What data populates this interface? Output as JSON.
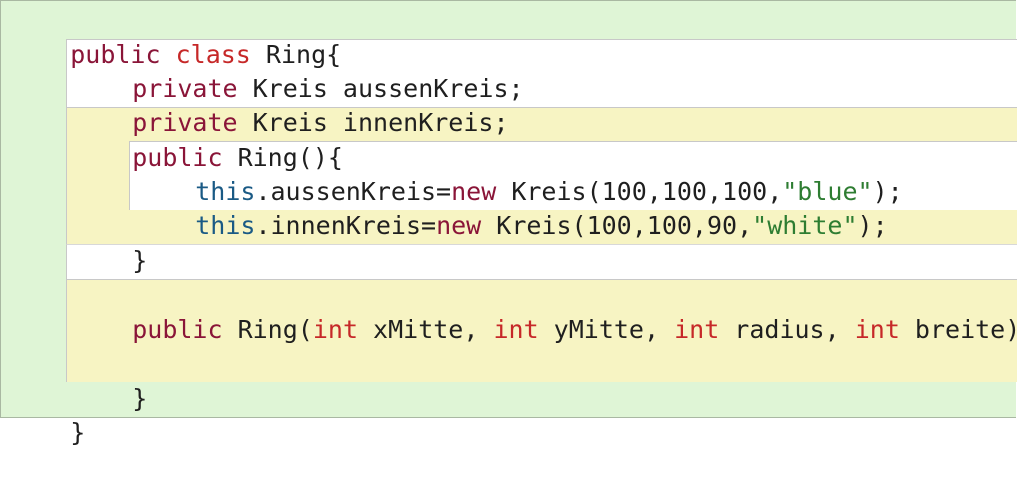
{
  "editor": {
    "lines": {
      "class_header": {
        "kw1": "public",
        "kw2": "class",
        "rest": " Ring{"
      },
      "field1": {
        "kw": "private",
        "rest": " Kreis aussenKreis;"
      },
      "field2": {
        "kw": "private",
        "rest": " Kreis innenKreis;"
      },
      "ctor1_header": {
        "kw": "public",
        "rest": " Ring(){"
      },
      "stmt1": {
        "this": "this",
        "mid1": ".aussenKreis=",
        "new": "new",
        "mid2": " Kreis(100,100,100,",
        "str": "\"blue\"",
        "end": ");"
      },
      "stmt2": {
        "this": "this",
        "mid1": ".innenKreis=",
        "new": "new",
        "mid2": " Kreis(100,100,90,",
        "str": "\"white\"",
        "end": ");"
      },
      "ctor1_close": "}",
      "ctor2_header": {
        "kw": "public",
        "name": " Ring(",
        "t1": "int",
        "p1": " xMitte, ",
        "t2": "int",
        "p2": " yMitte, ",
        "t3": "int",
        "p3": " radius, ",
        "t4": "int",
        "p4": " breite){"
      },
      "ctor2_close": "}",
      "class_close": "}"
    },
    "colors": {
      "keyword": "#8a1538",
      "type": "#c62828",
      "this": "#1a5a85",
      "string": "#2e7d32",
      "class_scope_bg": "#dff5d6",
      "method_scope_bg": "#f7f4c3",
      "body_scope_bg": "#ffffff"
    }
  }
}
